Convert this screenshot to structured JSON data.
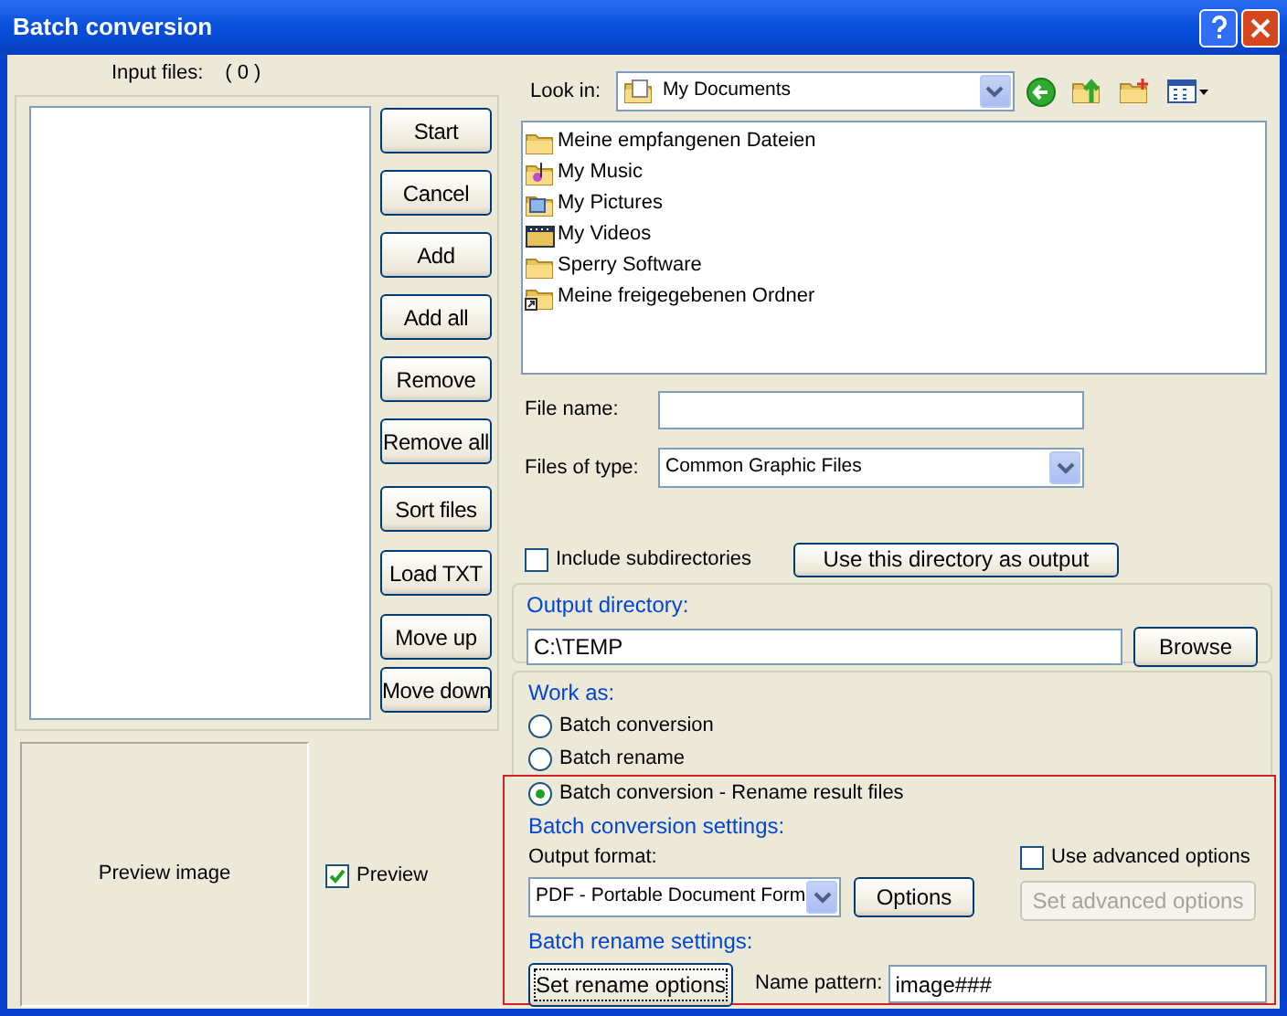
{
  "window": {
    "title": "Batch conversion"
  },
  "input_files": {
    "label": "Input files:",
    "count": "( 0 )"
  },
  "buttons": [
    "Start",
    "Cancel",
    "Add",
    "Add all",
    "Remove",
    "Remove all",
    "Sort files",
    "Load TXT",
    "Move up",
    "Move down"
  ],
  "preview": {
    "text": "Preview image",
    "checkbox": {
      "label": "Preview",
      "checked": true
    }
  },
  "browser": {
    "look_in_label": "Look in:",
    "look_in_value": "My Documents",
    "files": [
      {
        "name": "Meine empfangenen Dateien",
        "kind": "folder"
      },
      {
        "name": "My Music",
        "kind": "music"
      },
      {
        "name": "My Pictures",
        "kind": "pictures"
      },
      {
        "name": "My Videos",
        "kind": "videos"
      },
      {
        "name": "Sperry Software",
        "kind": "folder"
      },
      {
        "name": "Meine freigegebenen Ordner",
        "kind": "shared"
      }
    ],
    "file_name_label": "File name:",
    "file_type_label": "Files of type:",
    "file_type_value": "Common Graphic Files"
  },
  "include_subdirectories": {
    "label": "Include subdirectories",
    "checked": false
  },
  "use_dir_button": "Use this directory as output",
  "output_directory": {
    "legend": "Output directory:",
    "value": "C:\\TEMP",
    "button": "Browse"
  },
  "work_as": {
    "legend": "Work as:",
    "options": [
      {
        "label": "Batch conversion",
        "selected": false
      },
      {
        "label": "Batch rename",
        "selected": false
      },
      {
        "label": "Batch conversion - Rename result files",
        "selected": true
      }
    ]
  },
  "conversion_settings": {
    "legend": "Batch conversion settings:",
    "format_label": "Output format:",
    "format_value": "PDF - Portable Document Form",
    "options_button": "Options",
    "advanced": {
      "label": "Use advanced options",
      "checked": false
    },
    "advanced_button": {
      "label": "Set advanced options",
      "disabled": true
    }
  },
  "rename_settings": {
    "legend": "Batch rename settings:",
    "button": "Set rename options",
    "pattern_label": "Name pattern:",
    "pattern_value": "image###"
  }
}
